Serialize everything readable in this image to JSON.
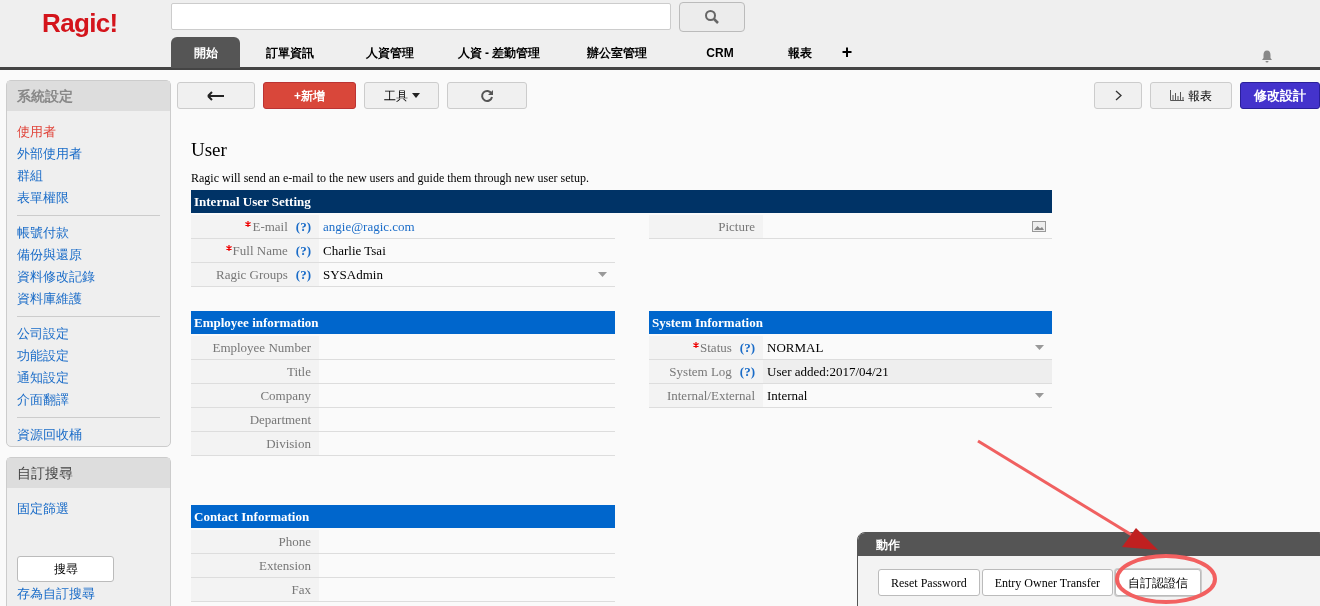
{
  "header": {
    "logo": "Ragic!",
    "tabs": [
      {
        "label": "開始",
        "selected": true
      },
      {
        "label": "訂單資訊",
        "selected": false
      },
      {
        "label": "人資管理",
        "selected": false
      },
      {
        "label": "人資 - 差勤管理",
        "selected": false
      },
      {
        "label": "辦公室管理",
        "selected": false
      },
      {
        "label": "CRM",
        "selected": false
      },
      {
        "label": "報表",
        "selected": false
      }
    ],
    "add_tab": "+"
  },
  "sidebar": {
    "panels": [
      {
        "title": "系統設定",
        "groups": [
          [
            {
              "label": "使用者",
              "selected": true
            },
            {
              "label": "外部使用者",
              "selected": false
            },
            {
              "label": "群組",
              "selected": false
            },
            {
              "label": "表單權限",
              "selected": false
            }
          ],
          [
            {
              "label": "帳號付款",
              "selected": false
            },
            {
              "label": "備份與還原",
              "selected": false
            },
            {
              "label": "資料修改記錄",
              "selected": false
            },
            {
              "label": "資料庫維護",
              "selected": false
            }
          ],
          [
            {
              "label": "公司設定",
              "selected": false
            },
            {
              "label": "功能設定",
              "selected": false
            },
            {
              "label": "通知設定",
              "selected": false
            },
            {
              "label": "介面翻譯",
              "selected": false
            }
          ],
          [
            {
              "label": "資源回收桶",
              "selected": false
            }
          ]
        ]
      },
      {
        "title": "自訂搜尋",
        "groups": [
          [
            {
              "label": "固定篩選",
              "selected": false
            }
          ]
        ],
        "button": "搜尋",
        "link": "存為自訂搜尋"
      }
    ]
  },
  "toolbar": {
    "left": [
      {
        "kind": "back"
      },
      {
        "kind": "primary",
        "label": "+新增"
      },
      {
        "kind": "menu",
        "label": "工具"
      },
      {
        "kind": "refresh"
      }
    ],
    "right": [
      {
        "kind": "next"
      },
      {
        "kind": "report",
        "label": "報表"
      },
      {
        "kind": "design",
        "label": "修改設計"
      }
    ]
  },
  "form": {
    "title": "User",
    "description": "Ragic will send an e-mail to the new users and guide them through new user setup.",
    "sections": [
      {
        "title": "Internal User Setting",
        "color": "#003366",
        "kind": "wide",
        "fields": [
          {
            "label": "E-mail",
            "required": true,
            "help": "(?)",
            "kind": "email",
            "value": "angie@ragic.com"
          },
          {
            "label": "Full Name",
            "required": true,
            "help": "(?)",
            "kind": "text",
            "value": "Charlie Tsai"
          },
          {
            "label": "Ragic Groups",
            "required": false,
            "help": "(?)",
            "kind": "select",
            "value": "SYSAdmin"
          }
        ],
        "side_fields": [
          {
            "label": "Picture",
            "required": false,
            "kind": "image"
          }
        ]
      },
      {
        "title": "Employee information",
        "color": "#0066cc",
        "kind": "left",
        "fields": [
          {
            "label": "Employee Number",
            "required": false,
            "kind": "text"
          },
          {
            "label": "Title",
            "required": false,
            "kind": "text"
          },
          {
            "label": "Company",
            "required": false,
            "kind": "text"
          },
          {
            "label": "Department",
            "required": false,
            "kind": "text"
          },
          {
            "label": "Division",
            "required": false,
            "kind": "text"
          }
        ]
      },
      {
        "title": "System Information",
        "color": "#0066cc",
        "kind": "right",
        "fields": [
          {
            "label": "Status",
            "required": true,
            "help": "(?)",
            "kind": "select",
            "value": "NORMAL"
          },
          {
            "label": "System Log",
            "required": false,
            "help": "(?)",
            "kind": "readonly",
            "value": "User added:2017/04/21"
          },
          {
            "label": "Internal/External",
            "required": false,
            "kind": "select",
            "value": "Internal"
          }
        ]
      },
      {
        "title": "Contact Information",
        "color": "#0066cc",
        "kind": "left",
        "fields": [
          {
            "label": "Phone",
            "required": false,
            "kind": "text"
          },
          {
            "label": "Extension",
            "required": false,
            "kind": "text"
          },
          {
            "label": "Fax",
            "required": false,
            "kind": "text"
          }
        ]
      }
    ]
  },
  "actions": {
    "title": "動作",
    "buttons": [
      {
        "label": "Reset Password",
        "highlighted": false
      },
      {
        "label": "Entry Owner Transfer",
        "highlighted": false
      },
      {
        "label": "自訂認證信",
        "highlighted": true
      }
    ]
  }
}
